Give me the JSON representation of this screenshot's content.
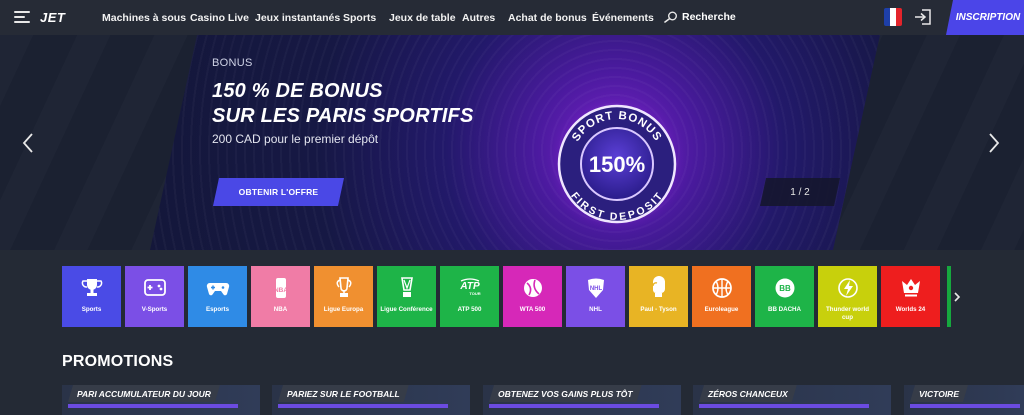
{
  "header": {
    "logo": "JET",
    "nav": [
      "Machines à sous",
      "Casino Live",
      "Jeux instantanés",
      "Sports",
      "Jeux de table",
      "Autres",
      "Achat de bonus",
      "Événements"
    ],
    "search_label": "Recherche",
    "signup_label": "INSCRIPTION",
    "language": "fr"
  },
  "hero": {
    "kicker": "BONUS",
    "title_line1": "150 % DE BONUS",
    "title_line2": "SUR LES PARIS SPORTIFS",
    "subtitle": "200 CAD pour le premier dépôt",
    "cta_label": "OBTENIR L'OFFRE",
    "badge_top": "SPORT BONUS",
    "badge_center": "150%",
    "badge_bottom": "FIRST DEPOSIT",
    "counter": "1 / 2"
  },
  "categories": [
    {
      "label": "Sports",
      "color": "#4a4be6",
      "icon": "trophy-icon"
    },
    {
      "label": "V-Sports",
      "color": "#7b4fe6",
      "icon": "gamepad-icon"
    },
    {
      "label": "Esports",
      "color": "#2f8be6",
      "icon": "controller-icon"
    },
    {
      "label": "NBA",
      "color": "#f07ca6",
      "icon": "nba-icon"
    },
    {
      "label": "Ligue Europa",
      "color": "#f09030",
      "icon": "europa-trophy-icon"
    },
    {
      "label": "Ligue Conférence",
      "color": "#1eb448",
      "icon": "conference-trophy-icon"
    },
    {
      "label": "ATP 500",
      "color": "#1eb448",
      "icon": "atp-icon"
    },
    {
      "label": "WTA 500",
      "color": "#d628b8",
      "icon": "wta-icon"
    },
    {
      "label": "NHL",
      "color": "#7b4fe6",
      "icon": "nhl-icon"
    },
    {
      "label": "Paul - Tyson",
      "color": "#e8b424",
      "icon": "boxing-glove-icon"
    },
    {
      "label": "Euroleague",
      "color": "#f07020",
      "icon": "basketball-icon"
    },
    {
      "label": "BB DACHA",
      "color": "#1eb448",
      "icon": "bb-dacha-icon"
    },
    {
      "label": "Thunder world cup",
      "color": "#c8d00c",
      "icon": "thunder-icon"
    },
    {
      "label": "Worlds 24",
      "color": "#ee1e1e",
      "icon": "worlds-icon"
    }
  ],
  "promotions": {
    "title": "PROMOTIONS",
    "items": [
      "PARI ACCUMULATEUR DU JOUR",
      "PARIEZ SUR LE FOOTBALL",
      "OBTENEZ VOS GAINS PLUS TÔT",
      "ZÉROS CHANCEUX",
      "VICTOIRE"
    ]
  }
}
